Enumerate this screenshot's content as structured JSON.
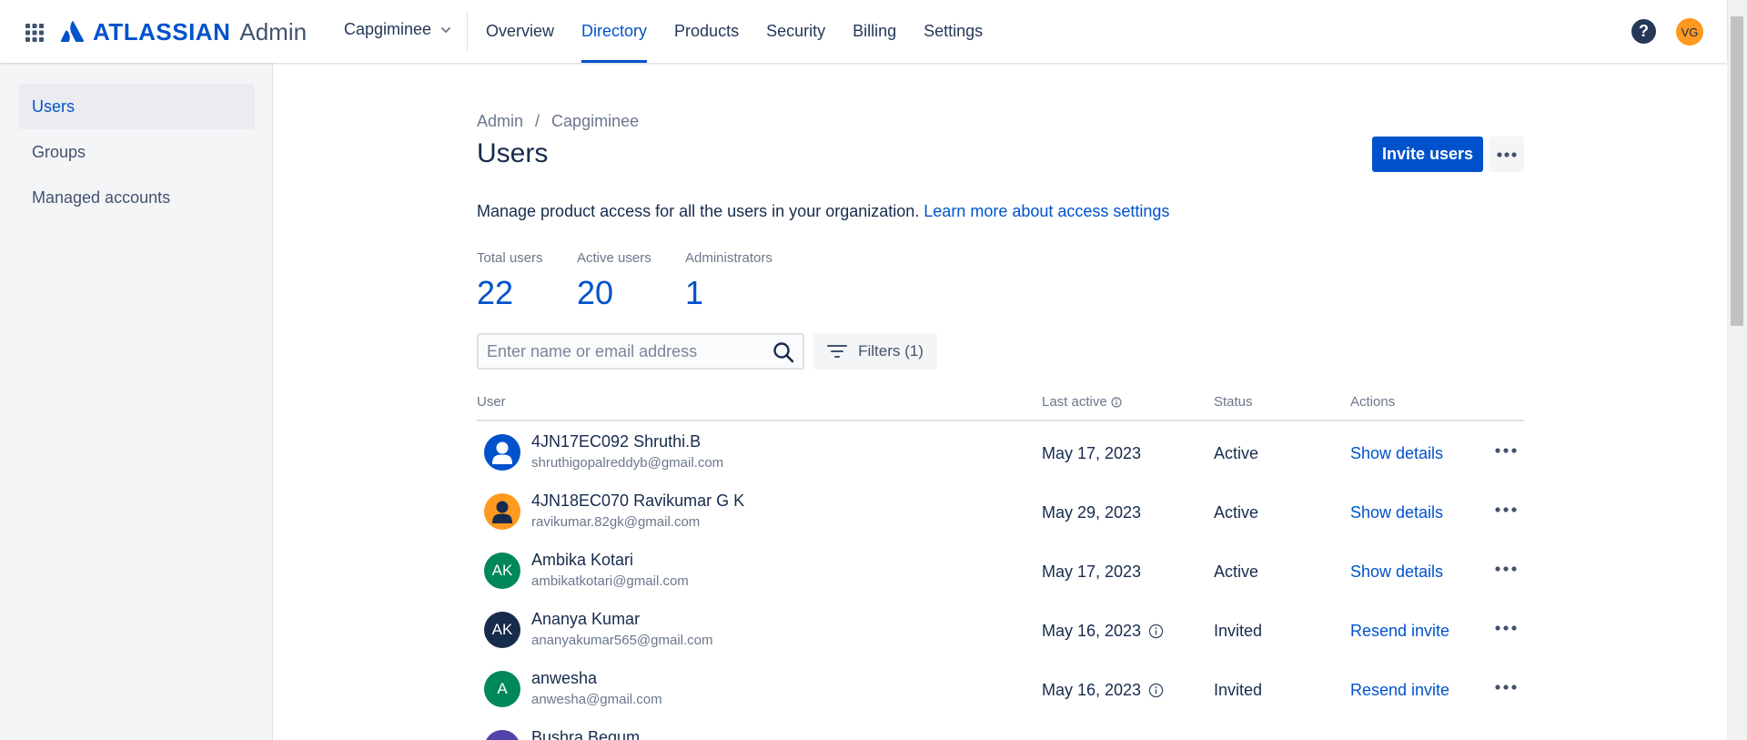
{
  "header": {
    "brand": "ATLASSIAN",
    "product": "Admin",
    "org": "Capgiminee",
    "nav": [
      "Overview",
      "Directory",
      "Products",
      "Security",
      "Billing",
      "Settings"
    ],
    "active_nav": "Directory",
    "help": "?",
    "user_initials": "VG"
  },
  "sidebar": {
    "items": [
      {
        "label": "Users",
        "active": true
      },
      {
        "label": "Groups",
        "active": false
      },
      {
        "label": "Managed accounts",
        "active": false
      }
    ]
  },
  "main": {
    "breadcrumb": [
      "Admin",
      "Capgiminee"
    ],
    "breadcrumb_sep": "/",
    "title": "Users",
    "invite_label": "Invite users",
    "description": "Manage product access for all the users in your organization.",
    "description_link": "Learn more about access settings",
    "stats": [
      {
        "label": "Total users",
        "value": "22"
      },
      {
        "label": "Active users",
        "value": "20"
      },
      {
        "label": "Administrators",
        "value": "1"
      }
    ],
    "search_placeholder": "Enter name or email address",
    "filters_label": "Filters (1)",
    "columns": {
      "user": "User",
      "last_active": "Last active",
      "status": "Status",
      "actions": "Actions"
    },
    "rows": [
      {
        "name": "4JN17EC092 Shruthi.B",
        "email": "shruthigopalreddyb@gmail.com",
        "last_active": "May 17, 2023",
        "status": "Active",
        "action": "Show details",
        "avatar_type": "default",
        "avatar_color": "#0052cc",
        "initials": ""
      },
      {
        "name": "4JN18EC070 Ravikumar G K",
        "email": "ravikumar.82gk@gmail.com",
        "last_active": "May 29, 2023",
        "status": "Active",
        "action": "Show details",
        "avatar_type": "default",
        "avatar_color": "#ff991f",
        "initials": ""
      },
      {
        "name": "Ambika Kotari",
        "email": "ambikatkotari@gmail.com",
        "last_active": "May 17, 2023",
        "status": "Active",
        "action": "Show details",
        "avatar_type": "initials",
        "avatar_color": "#00875a",
        "initials": "AK"
      },
      {
        "name": "Ananya Kumar",
        "email": "ananyakumar565@gmail.com",
        "last_active": "May 16, 2023",
        "status": "Invited",
        "action": "Resend invite",
        "avatar_type": "initials",
        "avatar_color": "#172b4d",
        "initials": "AK"
      },
      {
        "name": "anwesha",
        "email": "anwesha@gmail.com",
        "last_active": "May 16, 2023",
        "status": "Invited",
        "action": "Resend invite",
        "avatar_type": "initials",
        "avatar_color": "#00875a",
        "initials": "A"
      },
      {
        "name": "Bushra Begum",
        "email": "",
        "last_active": "",
        "status": "",
        "action": "",
        "avatar_type": "initials",
        "avatar_color": "#5243aa",
        "initials": ""
      }
    ]
  },
  "colors": {
    "primary": "#0052cc",
    "text": "#172b4d",
    "subtle": "#6b778c",
    "sidebar_bg": "#f4f5f7"
  }
}
